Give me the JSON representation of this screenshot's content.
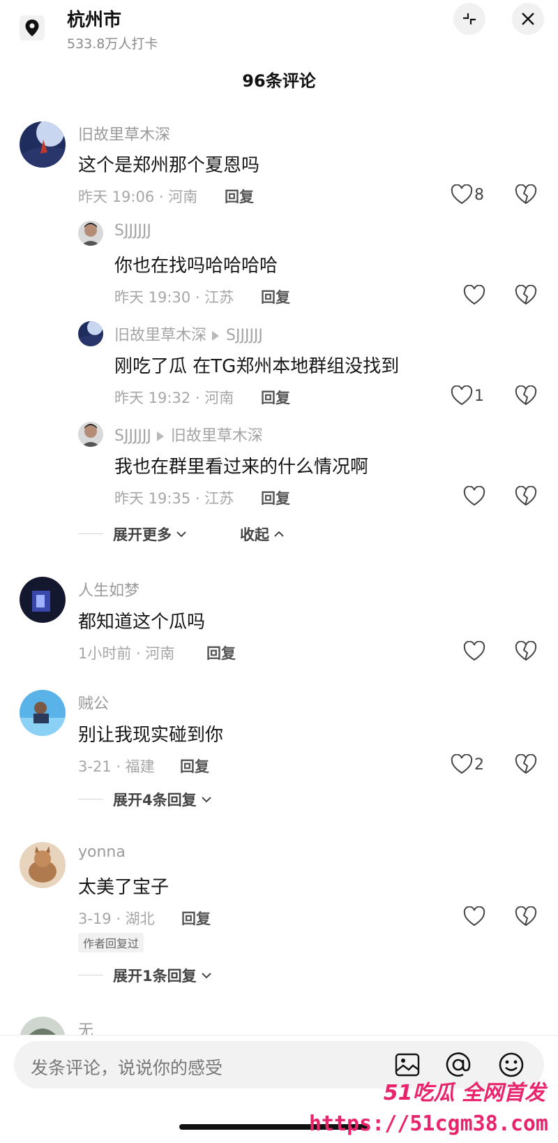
{
  "header": {
    "location_name": "杭州市",
    "checkins": "533.8万人打卡",
    "comment_count": "96条评论"
  },
  "comments": [
    {
      "user": "旧故里草木深",
      "text": "这个是郑州那个夏恩吗",
      "time_loc": "昨天 19:06 · 河南",
      "reply": "回复",
      "likes": "8",
      "replies": [
        {
          "user": "SJJJJJJ",
          "to": "",
          "text": "你也在找吗哈哈哈哈",
          "time_loc": "昨天 19:30 · 江苏",
          "reply": "回复",
          "likes": ""
        },
        {
          "user": "旧故里草木深",
          "to": "SJJJJJJ",
          "text": "刚吃了瓜 在TG郑州本地群组没找到",
          "time_loc": "昨天 19:32 · 河南",
          "reply": "回复",
          "likes": "1"
        },
        {
          "user": "SJJJJJJ",
          "to": "旧故里草木深",
          "text": "我也在群里看过来的什么情况啊",
          "time_loc": "昨天 19:35 · 江苏",
          "reply": "回复",
          "likes": ""
        }
      ],
      "expand_more": "展开更多",
      "collapse": "收起"
    },
    {
      "user": "人生如梦",
      "text": "都知道这个瓜吗",
      "time_loc": "1小时前 · 河南",
      "reply": "回复",
      "likes": ""
    },
    {
      "user": "贼公",
      "text": "别让我现实碰到你",
      "time_loc": "3-21 · 福建",
      "reply": "回复",
      "likes": "2",
      "expand": "展开4条回复"
    },
    {
      "user": "yonna",
      "text": "太美了宝子",
      "time_loc": "3-19 · 湖北",
      "reply": "回复",
      "likes": "",
      "badge": "作者回复过",
      "expand": "展开1条回复"
    },
    {
      "user": "无",
      "text": "",
      "time_loc": "",
      "reply": "",
      "likes": ""
    }
  ],
  "input": {
    "placeholder": "发条评论，说说你的感受"
  },
  "watermark": {
    "line1": "51吃瓜 全网首发",
    "line2": "https://51cgm38.com"
  },
  "colors": {
    "watermark": "#e8256c"
  }
}
